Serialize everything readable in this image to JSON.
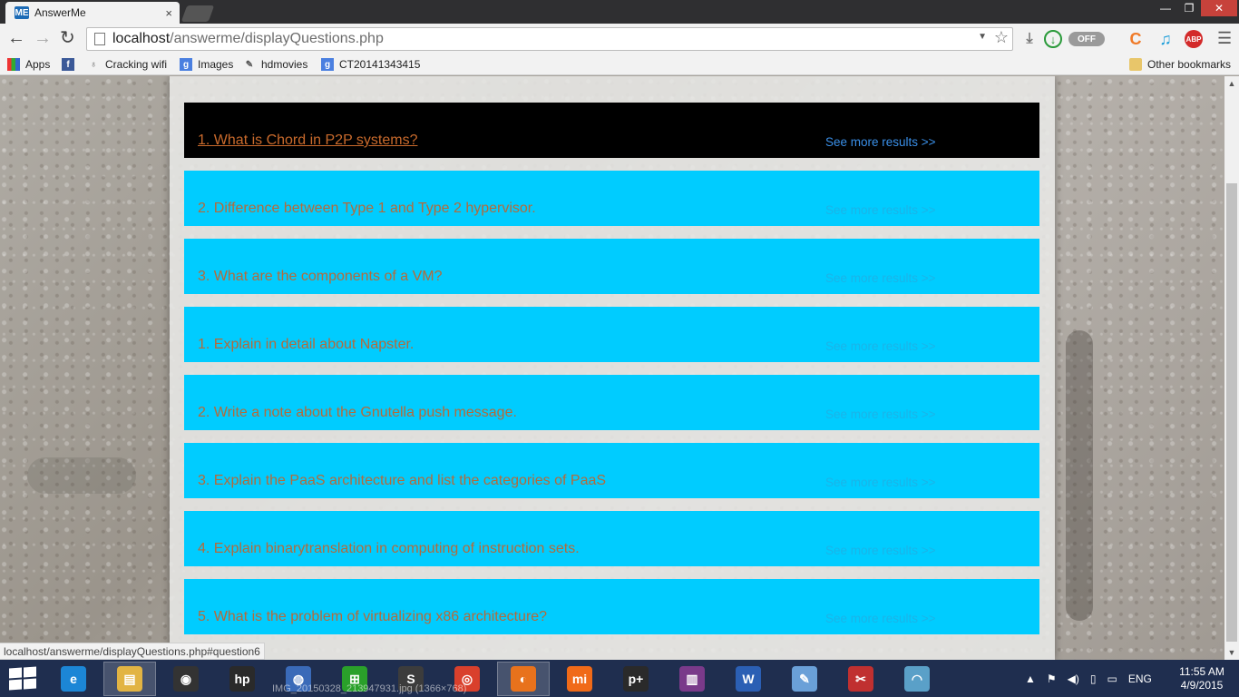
{
  "browser": {
    "tab_title": "AnswerMe",
    "tab_favicon": "ME",
    "tab_close": "×",
    "window_controls": {
      "minimize": "—",
      "maximize": "❐",
      "close": "✕"
    },
    "url_host": "localhost",
    "url_path": "/answerme/displayQuestions.php",
    "toggle_label": "OFF",
    "extensions": {
      "abp": "ABP"
    }
  },
  "bookmarks": [
    {
      "label": "Apps",
      "icon": "apps-grid-icon"
    },
    {
      "label": "Cracking wifi",
      "icon": "wifi-bookmark-icon"
    },
    {
      "label": "Images",
      "icon": "google-icon"
    },
    {
      "label": "hdmovies",
      "icon": "hdmovies-icon"
    },
    {
      "label": "CT20141343415",
      "icon": "google-icon"
    }
  ],
  "other_bookmarks": "Other bookmarks",
  "questions": [
    {
      "text": "1. What is Chord in P2P systems?",
      "more": "See more results >>"
    },
    {
      "text": "2. Difference between Type 1 and Type 2 hypervisor.",
      "more": "See more results >>"
    },
    {
      "text": "3. What are the components of a VM?",
      "more": "See more results >>"
    },
    {
      "text": "1. Explain in detail about Napster.",
      "more": "See more results >>"
    },
    {
      "text": "2. Write a note about the Gnutella push message.",
      "more": "See more results >>"
    },
    {
      "text": "3. Explain the PaaS architecture and list the categories of PaaS",
      "more": "See more results >>"
    },
    {
      "text": "4. Explain binarytranslation in computing of instruction sets.",
      "more": "See more results >>"
    },
    {
      "text": "5. What is the problem of virtualizing x86 architecture?",
      "more": "See more results >>"
    }
  ],
  "status_url": "localhost/answerme/displayQuestions.php#question6",
  "taskbar": {
    "peek_label": "IMG_20150328_213947931.jpg (1366×768)",
    "tray_lang": "ENG",
    "time": "11:55 AM",
    "date": "4/9/2015",
    "apps": [
      {
        "name": "ie-icon",
        "glyph": "e",
        "color": "#1c86d6"
      },
      {
        "name": "file-explorer-icon",
        "glyph": "▤",
        "color": "#e2b443"
      },
      {
        "name": "webcam-icon",
        "glyph": "◉",
        "color": "#333"
      },
      {
        "name": "hp-icon",
        "glyph": "hp",
        "color": "#2a2a2a"
      },
      {
        "name": "globe-icon",
        "glyph": "◍",
        "color": "#3a6ab8"
      },
      {
        "name": "store-icon",
        "glyph": "⊞",
        "color": "#2aa02a"
      },
      {
        "name": "sublime-icon",
        "glyph": "S",
        "color": "#3c3c3c"
      },
      {
        "name": "chrome-icon",
        "glyph": "◎",
        "color": "#d9402c"
      },
      {
        "name": "firefox-icon",
        "glyph": "◐",
        "color": "#e8721c"
      },
      {
        "name": "mi-icon",
        "glyph": "mi",
        "color": "#f06a18"
      },
      {
        "name": "media-player-icon",
        "glyph": "p+",
        "color": "#2a2a2a"
      },
      {
        "name": "winrar-icon",
        "glyph": "▥",
        "color": "#7a3a8a"
      },
      {
        "name": "word-icon",
        "glyph": "W",
        "color": "#2b5fb4"
      },
      {
        "name": "paint-icon",
        "glyph": "✎",
        "color": "#6aa0d8"
      },
      {
        "name": "snipping-tool-icon",
        "glyph": "✂",
        "color": "#c03030"
      },
      {
        "name": "network-icon",
        "glyph": "◠",
        "color": "#5aa0c8"
      }
    ]
  },
  "colors": {
    "card_bg": "#00ccff",
    "active_card_bg": "#000000",
    "question_text": "#b46a3a",
    "more_link": "#1ab4e8"
  }
}
